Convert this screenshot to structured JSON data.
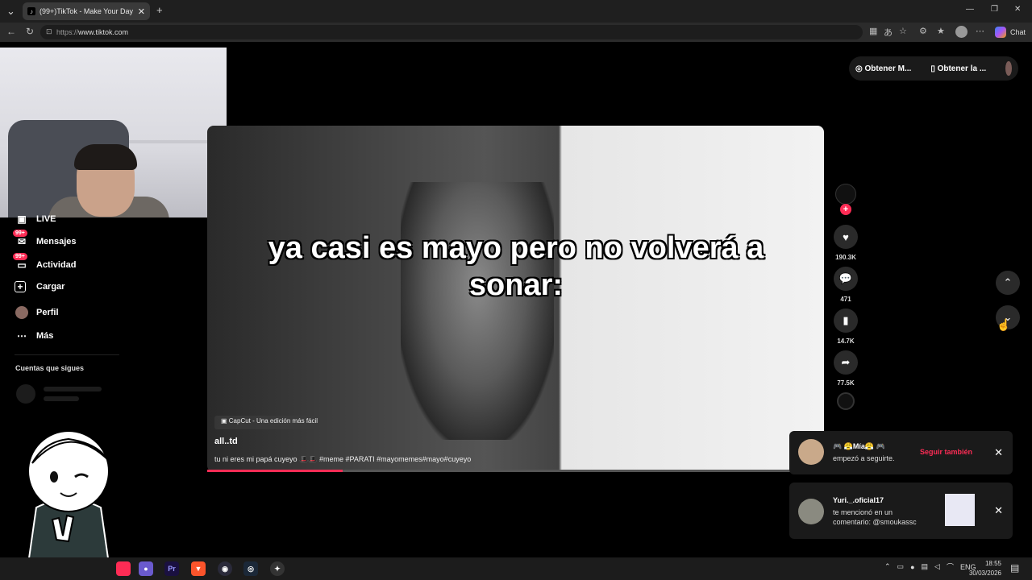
{
  "browser": {
    "tab_title": "(99+)TikTok - Make Your Day",
    "tab_close": "✕",
    "new_tab": "+",
    "url_protocol": "https://",
    "url_host": "www.tiktok.com",
    "chat_label": "Chat",
    "window_controls": {
      "minimize": "—",
      "maximize": "❐",
      "close": "✕"
    }
  },
  "header": {
    "get_coins": "Obtener M...",
    "get_app": "Obtener la ..."
  },
  "sidebar": {
    "items": [
      {
        "label": "LIVE",
        "icon": "live-icon",
        "badge": ""
      },
      {
        "label": "Mensajes",
        "icon": "messages-icon",
        "badge": "99+"
      },
      {
        "label": "Actividad",
        "icon": "activity-icon",
        "badge": "99+"
      },
      {
        "label": "Cargar",
        "icon": "upload-icon",
        "badge": ""
      },
      {
        "label": "Perfil",
        "icon": "profile-icon",
        "badge": ""
      },
      {
        "label": "Más",
        "icon": "more-icon",
        "badge": ""
      }
    ],
    "following_title": "Cuentas que sigues"
  },
  "video": {
    "caption": "ya casi es mayo pero no volverá a sonar:",
    "capcut_label": "CapCut - Una edición más fácil",
    "author": "all..td",
    "description": "tu ni eres mi papá cuyeyo 🎩🎩 #meme #PARATI #mayomemes#mayo#cuyeyo",
    "progress": 0.22
  },
  "actions": {
    "likes": "190.3K",
    "comments": "471",
    "saves": "14.7K",
    "shares": "77.5K"
  },
  "notifications": [
    {
      "name": "🎮 😤Mía😤 🎮",
      "message": "empezó a seguirte.",
      "action": "Seguir también"
    },
    {
      "name": "Yuri._.oficial17",
      "message_line1": "te mencionó en un",
      "message_line2": "comentario: @smoukassc"
    }
  ],
  "taskbar": {
    "language": "ENG",
    "time": "18:55",
    "date": "30/03/2026"
  },
  "colors": {
    "accent": "#fe2c55",
    "background": "#000000"
  }
}
